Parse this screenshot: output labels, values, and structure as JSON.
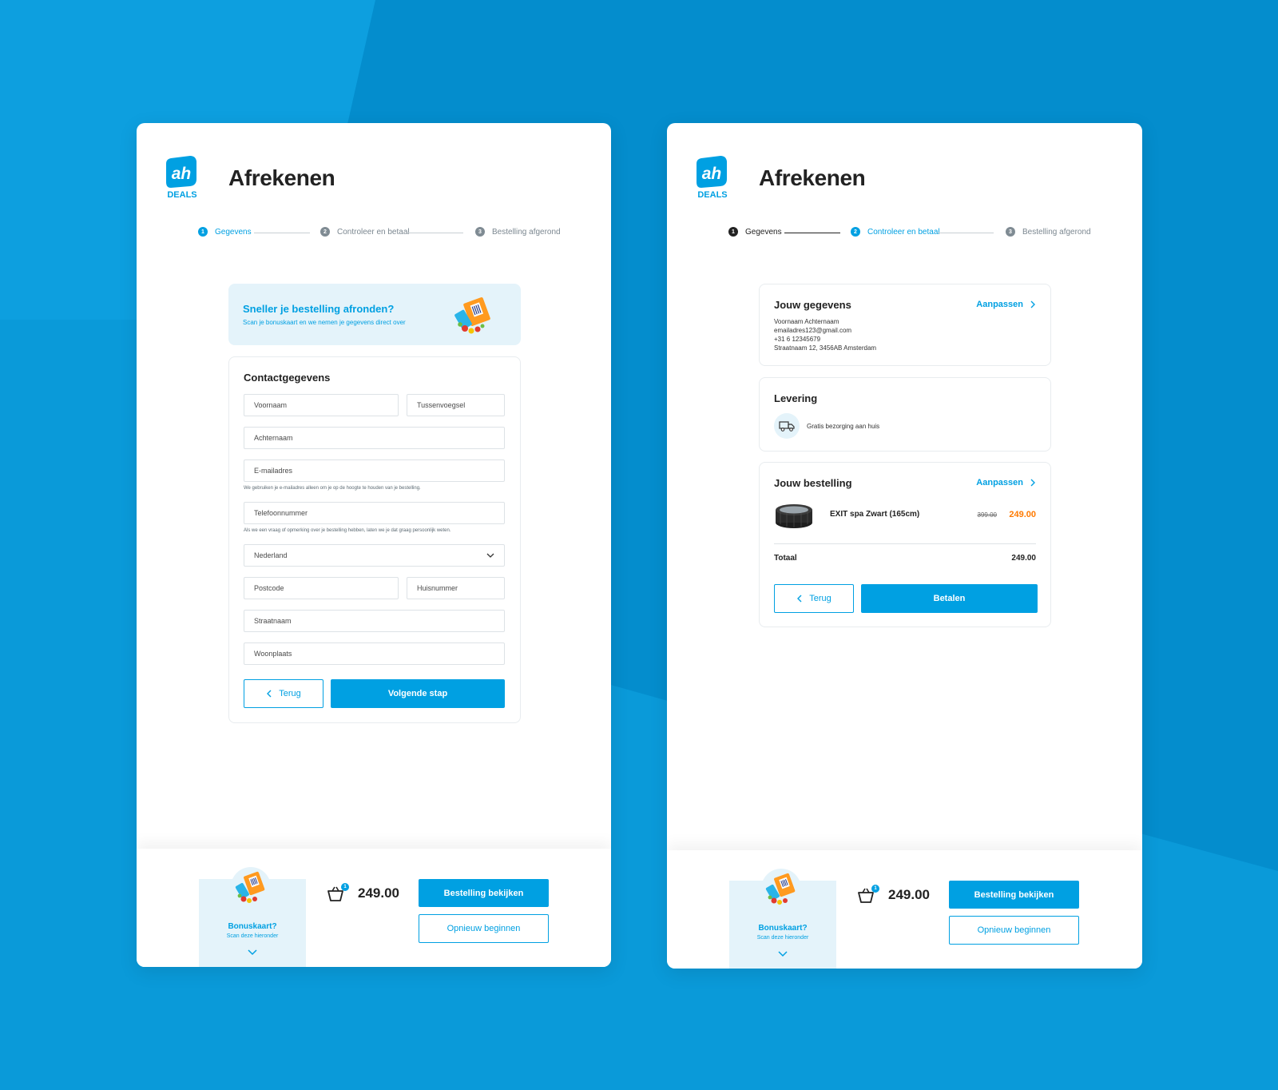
{
  "colors": {
    "brand_blue": "#00a0e2",
    "background": "#0a9ad9",
    "sale_orange": "#ff7a00",
    "light_blue": "#e4f3fa"
  },
  "left": {
    "title": "Afrekenen",
    "logo_text": "DEALS",
    "steps": [
      {
        "num": "1",
        "label": "Gegevens"
      },
      {
        "num": "2",
        "label": "Controleer en betaal"
      },
      {
        "num": "3",
        "label": "Bestelling afgerond"
      }
    ],
    "promo": {
      "title": "Sneller je bestelling afronden?",
      "subtitle": "Scan je bonuskaart en we nemen je gegevens direct over"
    },
    "form": {
      "title": "Contactgegevens",
      "first_name": "Voornaam",
      "infix": "Tussenvoegsel",
      "last_name": "Achternaam",
      "email": "E-mailadres",
      "email_hint": "We gebruiken je e-mailadres alleen om je op de hoogte te houden van je bestelling.",
      "phone": "Telefoonnummer",
      "phone_hint": "Als we een vraag of opmerking over je bestelling hebben, laten we je dat graag persoonlijk weten.",
      "country": "Nederland",
      "postcode": "Postcode",
      "house_number": "Huisnummer",
      "street": "Straatnaam",
      "city": "Woonplaats",
      "back_label": "Terug",
      "next_label": "Volgende stap"
    }
  },
  "right": {
    "title": "Afrekenen",
    "logo_text": "DEALS",
    "steps": [
      {
        "num": "1",
        "label": "Gegevens"
      },
      {
        "num": "2",
        "label": "Controleer en betaal"
      },
      {
        "num": "3",
        "label": "Bestelling afgerond"
      }
    ],
    "details": {
      "title": "Jouw gegevens",
      "edit_label": "Aanpassen",
      "lines": [
        "Voornaam Achternaam",
        "emailadres123@gmail.com",
        "+31 6 12345679",
        "Straatnaam 12, 3456AB Amsterdam"
      ]
    },
    "delivery": {
      "title": "Levering",
      "text": "Gratis bezorging aan huis",
      "icon": "truck-icon"
    },
    "order": {
      "title": "Jouw bestelling",
      "edit_label": "Aanpassen",
      "product_name": "EXIT spa Zwart (165cm)",
      "old_price": "399.00",
      "new_price": "249.00",
      "total_label": "Totaal",
      "total_value": "249.00",
      "back_label": "Terug",
      "pay_label": "Betalen"
    }
  },
  "footer": {
    "bonus_title": "Bonuskaart?",
    "bonus_sub": "Scan deze hieronder",
    "basket_count": "1",
    "total": "249.00",
    "view_order_label": "Bestelling bekijken",
    "restart_label": "Opnieuw beginnen"
  }
}
